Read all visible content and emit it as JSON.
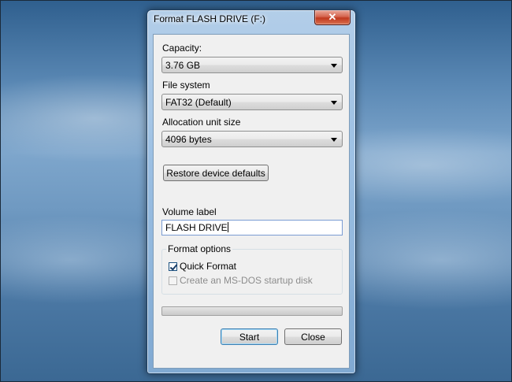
{
  "window": {
    "title": "Format FLASH DRIVE (F:)"
  },
  "close_glyph": "✕",
  "capacity": {
    "label": "Capacity:",
    "value": "3.76 GB"
  },
  "file_system": {
    "label": "File system",
    "value": "FAT32 (Default)"
  },
  "allocation": {
    "label": "Allocation unit size",
    "value": "4096 bytes"
  },
  "restore_button": "Restore device defaults",
  "volume": {
    "label": "Volume label",
    "value": "FLASH DRIVE"
  },
  "format_options": {
    "title": "Format options",
    "quick_format": {
      "label": "Quick Format",
      "checked": true
    },
    "msdos": {
      "label": "Create an MS-DOS startup disk",
      "checked": false,
      "enabled": false
    }
  },
  "progress": 0,
  "buttons": {
    "start": "Start",
    "close": "Close"
  },
  "colors": {
    "close_button": "#c0391f",
    "progress_fill": "#37b44a",
    "focus_border": "#3c7fb1"
  }
}
